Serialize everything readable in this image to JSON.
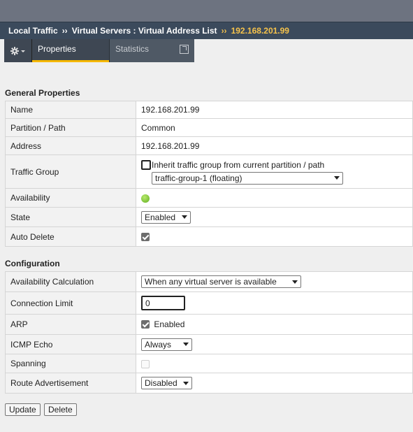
{
  "breadcrumb": {
    "part1": "Local Traffic",
    "sep": "››",
    "part2": "Virtual Servers : Virtual Address List",
    "current": "192.168.201.99"
  },
  "tabs": {
    "properties": "Properties",
    "statistics": "Statistics"
  },
  "general": {
    "title": "General Properties",
    "rows": {
      "name_label": "Name",
      "name_value": "192.168.201.99",
      "partition_label": "Partition / Path",
      "partition_value": "Common",
      "address_label": "Address",
      "address_value": "192.168.201.99",
      "traffic_group_label": "Traffic Group",
      "inherit_label": "Inherit traffic group from current partition / path",
      "inherit_checked": false,
      "traffic_group_value": "traffic-group-1 (floating)",
      "availability_label": "Availability",
      "availability_status": "available",
      "state_label": "State",
      "state_value": "Enabled",
      "auto_delete_label": "Auto Delete",
      "auto_delete_checked": true
    }
  },
  "configuration": {
    "title": "Configuration",
    "rows": {
      "avail_calc_label": "Availability Calculation",
      "avail_calc_value": "When any virtual server is available",
      "conn_limit_label": "Connection Limit",
      "conn_limit_value": "0",
      "arp_label": "ARP",
      "arp_value": "Enabled",
      "arp_checked": true,
      "icmp_label": "ICMP Echo",
      "icmp_value": "Always",
      "spanning_label": "Spanning",
      "spanning_checked": false,
      "route_adv_label": "Route Advertisement",
      "route_adv_value": "Disabled"
    }
  },
  "actions": {
    "update": "Update",
    "delete": "Delete"
  },
  "colors": {
    "header": "#3b4a5c",
    "accent": "#f5c24b",
    "tab_underline": "#f5b800",
    "status_green": "#5fae1e"
  }
}
